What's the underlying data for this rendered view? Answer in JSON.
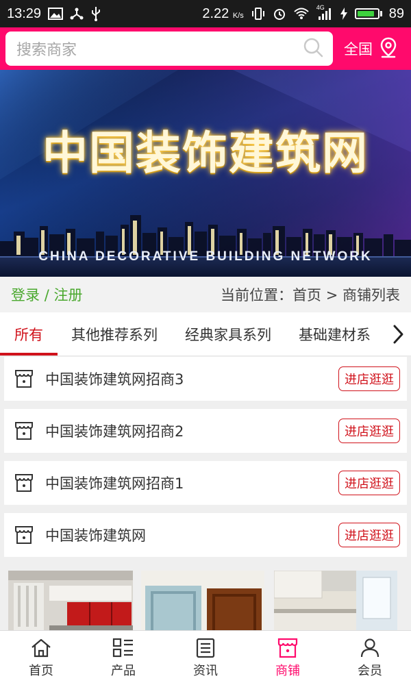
{
  "status_bar": {
    "time": "13:29",
    "speed": "2.22",
    "speed_unit": "K/s",
    "battery": "89",
    "battery_level": 0.89,
    "network": "4G"
  },
  "header": {
    "search_placeholder": "搜索商家",
    "region_label": "全国",
    "accent_color": "#ff0a6c"
  },
  "banner": {
    "title": "中国装饰建筑网",
    "subtitle": "CHINA DECORATIVE BUILDING NETWORK"
  },
  "breadcrumb": {
    "login": "登录",
    "separator": "/",
    "register": "注册",
    "location_prefix": "当前位置：",
    "home": "首页",
    "arrow": ">",
    "current": "商铺列表"
  },
  "tabs": [
    {
      "label": "所有",
      "active": true
    },
    {
      "label": "其他推荐系列",
      "active": false
    },
    {
      "label": "经典家具系列",
      "active": false
    },
    {
      "label": "基础建材系",
      "active": false
    }
  ],
  "shops": [
    {
      "name": "中国装饰建筑网招商3",
      "button": "进店逛逛"
    },
    {
      "name": "中国装饰建筑网招商2",
      "button": "进店逛逛"
    },
    {
      "name": "中国装饰建筑网招商1",
      "button": "进店逛逛"
    },
    {
      "name": "中国装饰建筑网",
      "button": "进店逛逛"
    }
  ],
  "bottom_nav": [
    {
      "label": "首页",
      "icon": "home-icon",
      "active": false
    },
    {
      "label": "产品",
      "icon": "product-grid-icon",
      "active": false
    },
    {
      "label": "资讯",
      "icon": "news-icon",
      "active": false
    },
    {
      "label": "商铺",
      "icon": "shop-icon",
      "active": true
    },
    {
      "label": "会员",
      "icon": "member-icon",
      "active": false
    }
  ]
}
